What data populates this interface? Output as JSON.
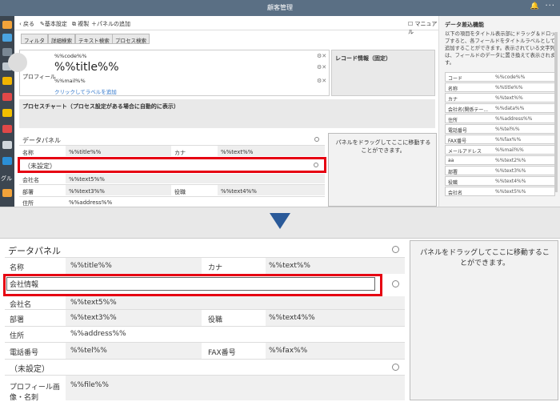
{
  "window": {
    "title": "顧客管理"
  },
  "toolbar": {
    "back": "戻る",
    "basic_settings": "基本設定",
    "copy": "複製",
    "add_panel": "パネルの追加",
    "manual": "マニュアル"
  },
  "search_buttons": [
    "フィルタ",
    "詳細検索",
    "テキスト検索",
    "プロセス検索"
  ],
  "header_card": {
    "code": "%%code%%",
    "title": "%%title%%",
    "mail": "%%mail%%",
    "hint": "クリックしてラベルを追加",
    "avatar_label": "プロフィール"
  },
  "record_info_title": "レコード情報（固定）",
  "process_chart_title": "プロセスチャート（プロセス設定がある場合に自動的に表示）",
  "help": {
    "title": "データ差込機能",
    "text": "以下の項目をタイトル表示部にドラッグ＆ドロップすると、各フィールドをタイトルラベルとして追加することができます。表示されている文字列は、フィールドのデータに置き換えて表示されます。",
    "fields": [
      {
        "key": "コード",
        "value": "%%code%%"
      },
      {
        "key": "名称",
        "value": "%%title%%"
      },
      {
        "key": "カナ",
        "value": "%%text%%"
      },
      {
        "key": "会社名(関係テー...",
        "value": "%%data%%"
      },
      {
        "key": "住所",
        "value": "%%address%%"
      },
      {
        "key": "電話番号",
        "value": "%%tel%%"
      },
      {
        "key": "FAX番号",
        "value": "%%fax%%"
      },
      {
        "key": "メールアドレス",
        "value": "%%mail%%"
      },
      {
        "key": "aa",
        "value": "%%text2%%"
      },
      {
        "key": "部署",
        "value": "%%text3%%"
      },
      {
        "key": "役職",
        "value": "%%text4%%"
      },
      {
        "key": "会社名",
        "value": "%%text5%%"
      }
    ]
  },
  "sidebar_label": "グル",
  "small_panel": {
    "title": "データパネル",
    "name_label": "名称",
    "name_value": "%%title%%",
    "kana_label": "カナ",
    "kana_value": "%%text%%",
    "unset": "（未設定）",
    "company_label": "会社名",
    "company_value": "%%text5%%",
    "dept_label": "部署",
    "dept_value": "%%text3%%",
    "role_label": "役職",
    "role_value": "%%text4%%",
    "addr_label": "住所",
    "addr_value": "%%address%%"
  },
  "drop_hint": "パネルをドラッグしてここに移動することができます。",
  "big_panel": {
    "title": "データパネル",
    "name_label": "名称",
    "name_value": "%%title%%",
    "kana_label": "カナ",
    "kana_value": "%%text%%",
    "category_input": "会社情報",
    "company_label": "会社名",
    "company_value": "%%text5%%",
    "dept_label": "部署",
    "dept_value": "%%text3%%",
    "role_label": "役職",
    "role_value": "%%text4%%",
    "addr_label": "住所",
    "addr_value": "%%address%%",
    "tel_label": "電話番号",
    "tel_value": "%%tel%%",
    "fax_label": "FAX番号",
    "fax_value": "%%fax%%",
    "unset": "（未設定）",
    "file_label_1": "プロフィール画",
    "file_label_2": "像・名刺",
    "file_value": "%%file%%"
  },
  "colors": {
    "titlebar": "#5a6f84",
    "sidebar": "#3c4650",
    "highlight": "#e60012",
    "arrow": "#2b5a99"
  }
}
